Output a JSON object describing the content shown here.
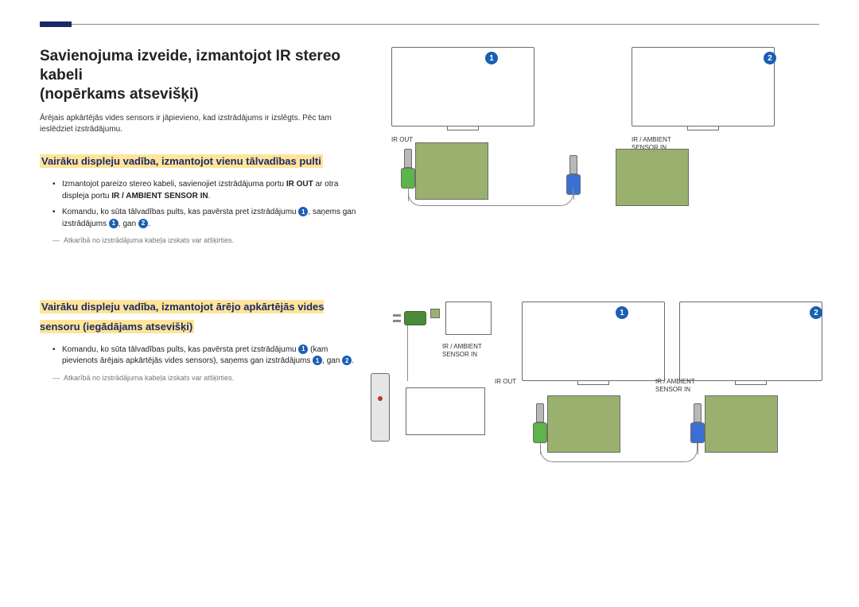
{
  "title_line1": "Savienojuma izveide, izmantojot IR stereo kabeli",
  "title_line2": "(nopērkams atsevišķi)",
  "intro": "Ārējais apkārtējās vides sensors ir jāpievieno, kad izstrādājums ir izslēgts. Pēc tam ieslēdziet izstrādājumu.",
  "section1": {
    "heading": "Vairāku displeju vadība, izmantojot vienu tālvadības pulti",
    "bullets": [
      {
        "pre": "Izmantojot pareizo stereo kabeli, savienojiet izstrādājuma portu ",
        "b1": "IR OUT",
        "mid": " ar otra displeja portu ",
        "b2": "IR / AMBIENT SENSOR IN",
        "post": "."
      },
      {
        "pre": "Komandu, ko sūta tālvadības pults, kas pavērsta pret izstrādājumu ",
        "n1": "1",
        "mid1": ", saņems gan izstrādājums ",
        "n2": "1",
        "mid2": ", gan ",
        "n3": "2",
        "post": "."
      }
    ],
    "footnote": "Atkarībā no izstrādājuma kabeļa izskats var atšķirties."
  },
  "section2": {
    "heading": "Vairāku displeju vadība, izmantojot ārējo apkārtējās vides sensoru (iegādājams atsevišķi)",
    "bullets": [
      {
        "pre": "Komandu, ko sūta tālvadības pults, kas pavērsta pret izstrādājumu ",
        "n1": "1",
        "mid1": " (kam pievienots ārējais apkārtējās vides sensors), saņems gan izstrādājums ",
        "n2": "1",
        "mid2": ", gan ",
        "n3": "2",
        "post": "."
      }
    ],
    "footnote": "Atkarībā no izstrādājuma kabeļa izskats var atšķirties."
  },
  "labels": {
    "ir_out": "IR OUT",
    "ir_ambient": "IR / AMBIENT",
    "sensor_in": "SENSOR IN",
    "one": "1",
    "two": "2"
  }
}
